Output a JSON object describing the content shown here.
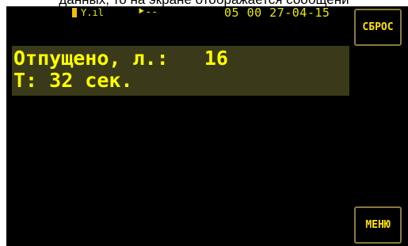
{
  "caption": "данных, то на экране отображается сообщени",
  "status": {
    "datetime": "05 00 27-04-15",
    "gps": "⯈--",
    "battery_icon": "battery-icon",
    "antenna_icon": "antenna-signal-icon"
  },
  "display": {
    "line1_label": "Отпущено, л.:",
    "line1_value": "16",
    "line2": "Т: 32 сек."
  },
  "softkeys": {
    "reset": "СБРОС",
    "menu": "МЕНЮ"
  },
  "colors": {
    "text": "#ffff00",
    "panel": "#3a3a1a",
    "screen": "#000000",
    "button_border": "#8a7a3a"
  }
}
